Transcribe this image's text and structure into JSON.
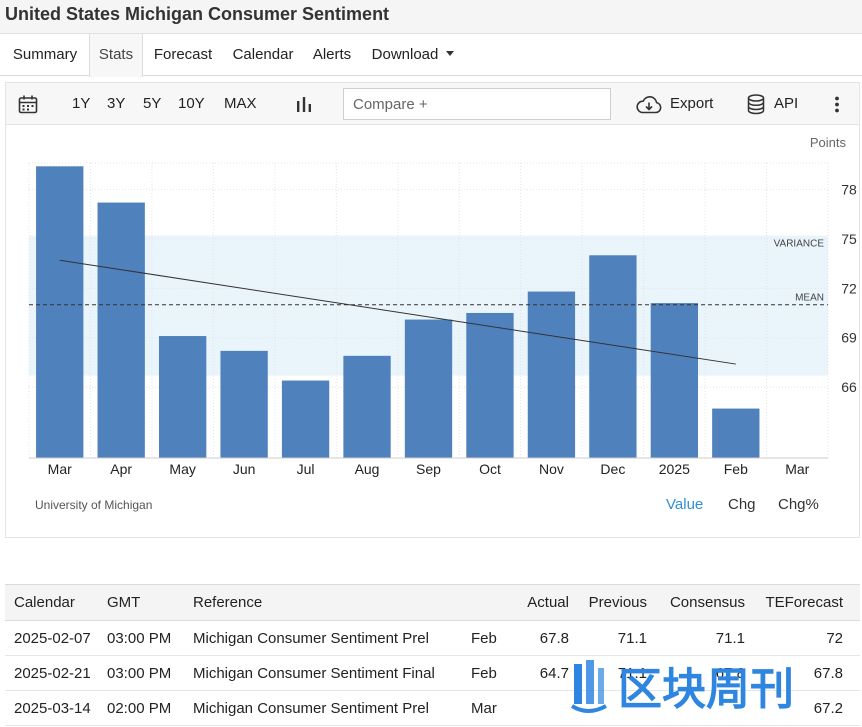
{
  "page": {
    "title": "United States Michigan Consumer Sentiment"
  },
  "tabs": [
    {
      "label": "Summary",
      "active": false
    },
    {
      "label": "Stats",
      "active": true
    },
    {
      "label": "Forecast",
      "active": false
    },
    {
      "label": "Calendar",
      "active": false
    },
    {
      "label": "Alerts",
      "active": false
    },
    {
      "label": "Download",
      "active": false
    }
  ],
  "toolbar": {
    "ranges": [
      "1Y",
      "3Y",
      "5Y",
      "10Y",
      "MAX"
    ],
    "compare_placeholder": "Compare +",
    "export_label": "Export",
    "api_label": "API",
    "icons": [
      "calendar-icon",
      "bar-chart-icon",
      "cloud-download-icon",
      "database-icon",
      "more-vertical-icon"
    ]
  },
  "chart_data": {
    "type": "bar",
    "units": "Points",
    "categories": [
      "Mar",
      "Apr",
      "May",
      "Jun",
      "Jul",
      "Aug",
      "Sep",
      "Oct",
      "Nov",
      "Dec",
      "2025",
      "Feb",
      "Mar"
    ],
    "values": [
      79.4,
      77.2,
      69.1,
      68.2,
      66.4,
      67.9,
      70.1,
      70.5,
      71.8,
      74.0,
      71.1,
      64.7,
      null
    ],
    "ylim": [
      61.7,
      79.6
    ],
    "yticks": [
      66,
      69,
      72,
      75,
      78
    ],
    "mean": 71.0,
    "mean_label": "MEAN",
    "variance_band": [
      66.7,
      75.2
    ],
    "variance_label": "VARIANCE",
    "trend": {
      "start": 73.7,
      "end": 67.4
    },
    "bar_color": "#4f81bd",
    "grid": true
  },
  "source": "University of Michigan",
  "view_options": [
    {
      "label": "Value",
      "active": true
    },
    {
      "label": "Chg",
      "active": false
    },
    {
      "label": "Chg%",
      "active": false
    }
  ],
  "calendar_table": {
    "columns": [
      "Calendar",
      "GMT",
      "Reference",
      "",
      "Actual",
      "Previous",
      "Consensus",
      "TEForecast"
    ],
    "rows": [
      [
        "2025-02-07",
        "03:00 PM",
        "Michigan Consumer Sentiment Prel",
        "Feb",
        "67.8",
        "71.1",
        "71.1",
        "72"
      ],
      [
        "2025-02-21",
        "03:00 PM",
        "Michigan Consumer Sentiment Final",
        "Feb",
        "64.7",
        "71.1",
        "67.8",
        "67.8"
      ],
      [
        "2025-03-14",
        "02:00 PM",
        "Michigan Consumer Sentiment Prel",
        "Mar",
        "",
        "",
        "",
        "67.2"
      ]
    ]
  },
  "watermark": {
    "text": "区块周刊",
    "color": "#2f86e0"
  }
}
